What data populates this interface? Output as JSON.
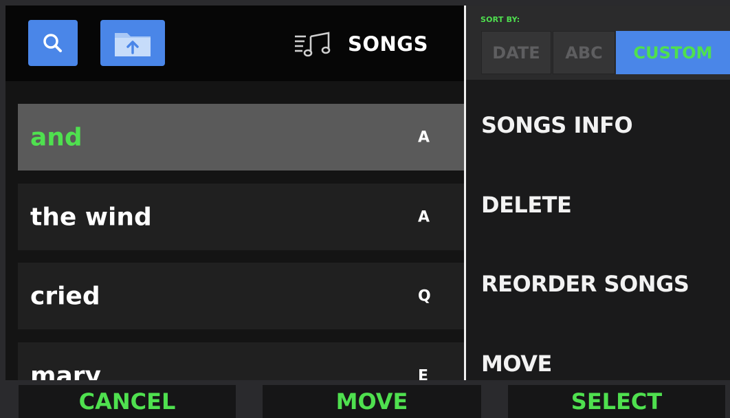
{
  "header": {
    "title": "SONGS",
    "search_icon": "search-icon",
    "upload_icon": "folder-upload-icon",
    "songs_icon": "music-list-icon"
  },
  "songs": [
    {
      "name": "and",
      "key": "A",
      "selected": true
    },
    {
      "name": "the wind",
      "key": "A",
      "selected": false
    },
    {
      "name": "cried",
      "key": "Q",
      "selected": false
    },
    {
      "name": "mary",
      "key": "E",
      "selected": false
    }
  ],
  "sort": {
    "label": "SORT BY:",
    "options": [
      "DATE",
      "ABC",
      "CUSTOM"
    ],
    "selected": "CUSTOM"
  },
  "menu": {
    "songs_info": "SONGS INFO",
    "delete": "DELETE",
    "reorder": "REORDER SONGS",
    "move": "MOVE"
  },
  "bottom": {
    "cancel": "CANCEL",
    "move": "MOVE",
    "select": "SELECT"
  },
  "colors": {
    "accent_green": "#4fe04f",
    "accent_blue": "#4a86e8",
    "selected_row": "#5a5a5a",
    "row": "#202020"
  }
}
